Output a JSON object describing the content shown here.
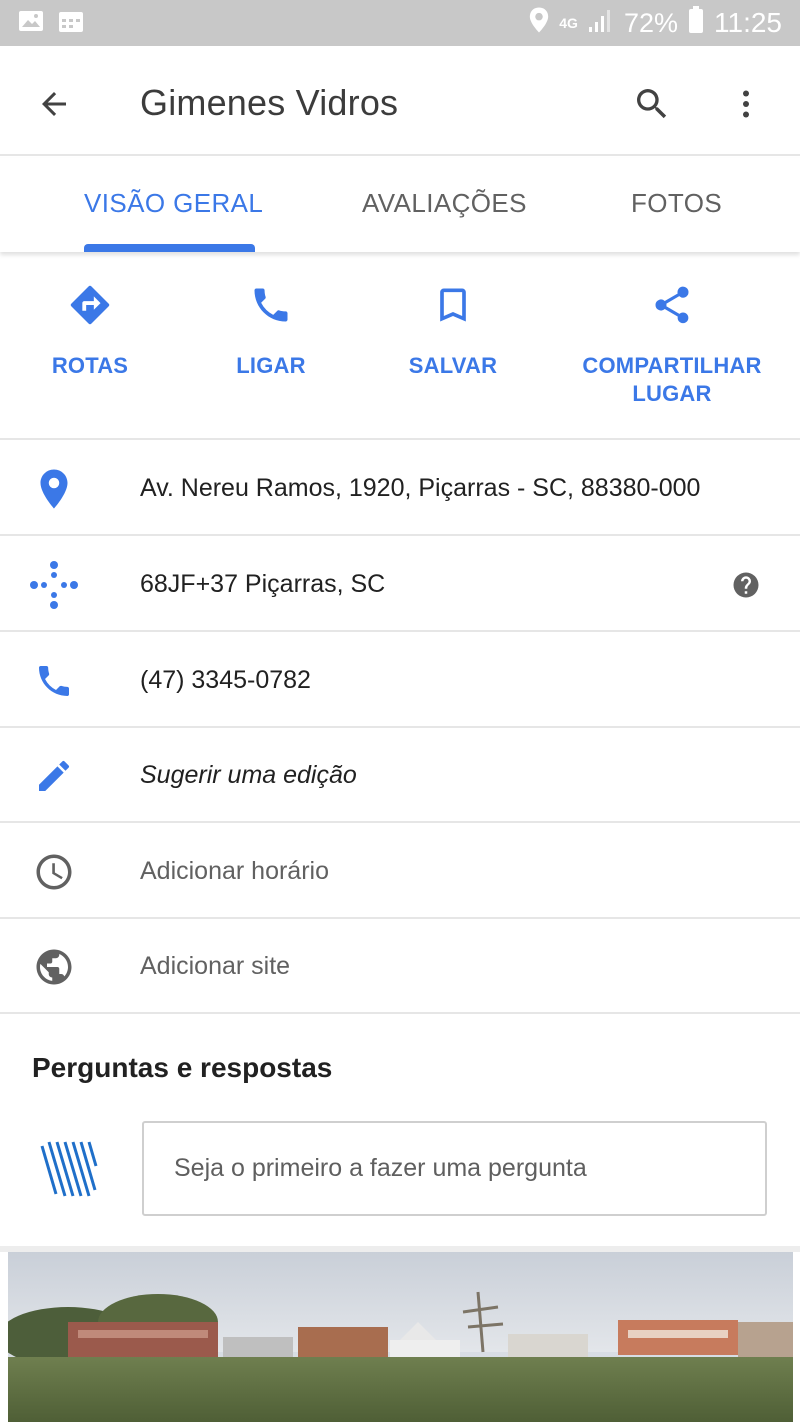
{
  "status_bar": {
    "network": "4G",
    "battery": "72%",
    "time": "11:25"
  },
  "app_bar": {
    "title": "Gimenes Vidros"
  },
  "tabs": [
    {
      "label": "VISÃO GERAL",
      "active": true
    },
    {
      "label": "AVALIAÇÕES",
      "active": false
    },
    {
      "label": "FOTOS",
      "active": false
    }
  ],
  "actions": [
    {
      "label": "ROTAS",
      "icon": "directions-icon"
    },
    {
      "label": "LIGAR",
      "icon": "phone-icon"
    },
    {
      "label": "SALVAR",
      "icon": "bookmark-icon"
    },
    {
      "label": "COMPARTILHAR LUGAR",
      "icon": "share-icon"
    }
  ],
  "info": {
    "address": "Av. Nereu Ramos, 1920, Piçarras - SC, 88380-000",
    "plus_code": "68JF+37 Piçarras, SC",
    "phone": "(47) 3345-0782",
    "suggest_edit": "Sugerir uma edição",
    "add_hours": "Adicionar horário",
    "add_site": "Adicionar site"
  },
  "qa": {
    "title": "Perguntas e respostas",
    "placeholder": "Seja o primeiro a fazer uma pergunta"
  },
  "colors": {
    "accent": "#3b78e7",
    "status_bar": "#c8c8c8",
    "divider": "#e6e6e6",
    "icon_grey": "#616161"
  }
}
